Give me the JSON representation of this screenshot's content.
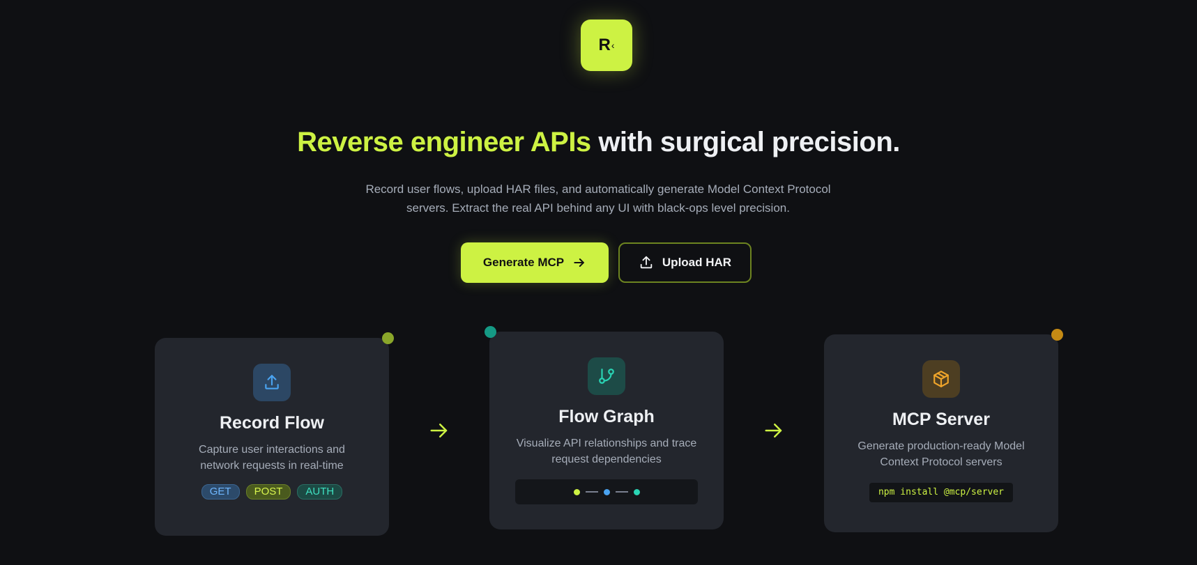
{
  "logo": {
    "letter": "R",
    "chevron": "‹"
  },
  "hero": {
    "headline_accent": "Reverse engineer APIs",
    "headline_rest": "with surgical precision.",
    "subtitle_line1": "Record user flows, upload HAR files, and automatically generate Model Context Protocol",
    "subtitle_line2": "servers. Extract the real API behind any UI with black-ops level precision."
  },
  "actions": {
    "primary_label": "Generate MCP",
    "primary_icon": "arrow-right-icon",
    "secondary_label": "Upload HAR",
    "secondary_icon": "upload-icon"
  },
  "cards": [
    {
      "title": "Record Flow",
      "desc_line1": "Capture user interactions and",
      "desc_line2": "network requests in real-time",
      "icon": "upload-icon",
      "dot_color": "#8aa62a",
      "tags": [
        "GET",
        "POST",
        "AUTH"
      ]
    },
    {
      "title": "Flow Graph",
      "desc_line1": "Visualize API relationships and trace",
      "desc_line2": "request dependencies",
      "icon": "git-branch-icon",
      "dot_color": "#159a85"
    },
    {
      "title": "MCP Server",
      "desc_line1": "Generate production-ready Model",
      "desc_line2": "Context Protocol servers",
      "icon": "package-icon",
      "dot_color": "#c48a14",
      "code": "npm install @mcp/server"
    }
  ],
  "colors": {
    "accent": "#cdf243",
    "background": "#0f1013",
    "card": "#23262d",
    "blue": "#4aa3f0",
    "teal": "#2ad4b4",
    "amber": "#f0a52a"
  }
}
